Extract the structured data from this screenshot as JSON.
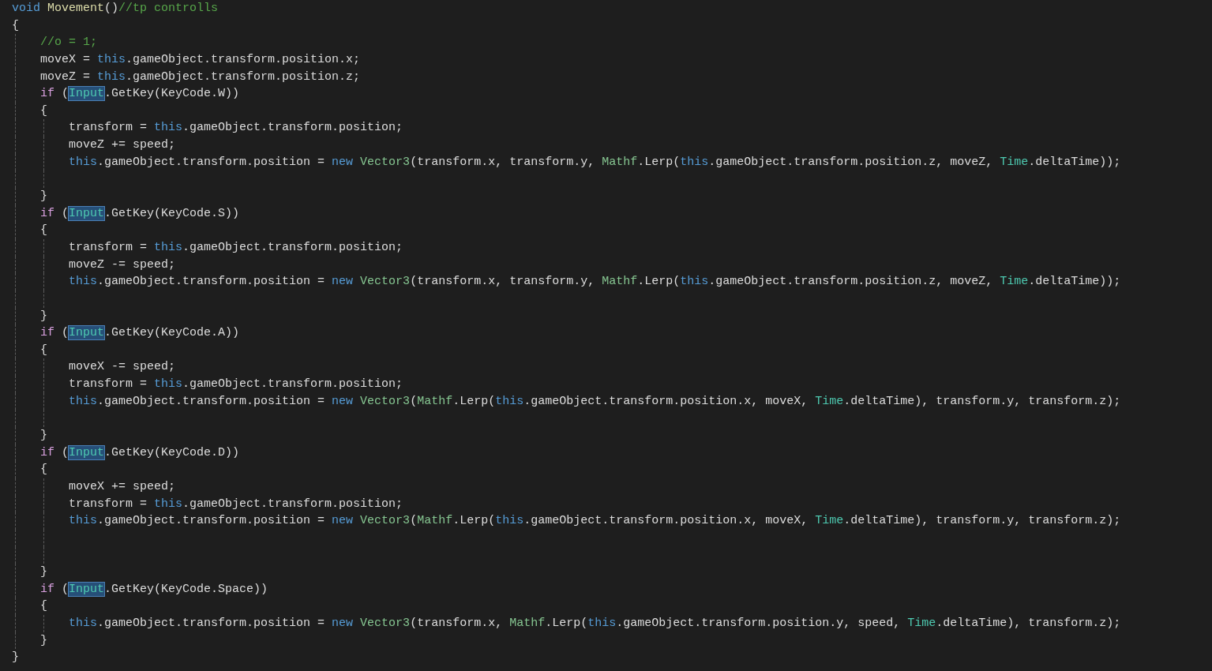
{
  "editor": {
    "lines": [
      {
        "kind": "code",
        "tokens": [
          {
            "text": "void ",
            "kind": "keyword"
          },
          {
            "text": "Movement",
            "kind": "function"
          },
          {
            "text": "()",
            "kind": "plain"
          },
          {
            "text": "//tp controlls",
            "kind": "comment"
          }
        ]
      },
      {
        "kind": "code",
        "tokens": [
          {
            "text": "{",
            "kind": "plain"
          }
        ]
      },
      {
        "kind": "code",
        "tokens": [
          {
            "text": "    //o = 1;",
            "kind": "comment"
          }
        ]
      },
      {
        "kind": "code",
        "tokens": [
          {
            "text": "    moveX = ",
            "kind": "plain"
          },
          {
            "text": "this",
            "kind": "keyword"
          },
          {
            "text": ".gameObject.transform.position.x;",
            "kind": "plain"
          }
        ]
      },
      {
        "kind": "code",
        "tokens": [
          {
            "text": "    moveZ = ",
            "kind": "plain"
          },
          {
            "text": "this",
            "kind": "keyword"
          },
          {
            "text": ".gameObject.transform.position.z;",
            "kind": "plain"
          }
        ]
      },
      {
        "kind": "code",
        "tokens": [
          {
            "text": "    if",
            "kind": "control"
          },
          {
            "text": " (",
            "kind": "plain"
          },
          {
            "text": "Input",
            "kind": "type",
            "highlighted": true
          },
          {
            "text": ".GetKey(KeyCode.W))",
            "kind": "plain"
          }
        ]
      },
      {
        "kind": "code",
        "tokens": [
          {
            "text": "    {",
            "kind": "plain"
          }
        ]
      },
      {
        "kind": "code",
        "tokens": [
          {
            "text": "        transform = ",
            "kind": "plain"
          },
          {
            "text": "this",
            "kind": "keyword"
          },
          {
            "text": ".gameObject.transform.position;",
            "kind": "plain"
          }
        ]
      },
      {
        "kind": "code",
        "tokens": [
          {
            "text": "        moveZ += speed;",
            "kind": "plain"
          }
        ]
      },
      {
        "kind": "code",
        "tokens": [
          {
            "text": "        this",
            "kind": "keyword"
          },
          {
            "text": ".gameObject.transform.position = ",
            "kind": "plain"
          },
          {
            "text": "new ",
            "kind": "keyword"
          },
          {
            "text": "Vector3",
            "kind": "struct"
          },
          {
            "text": "(transform.x, transform.y, ",
            "kind": "plain"
          },
          {
            "text": "Mathf",
            "kind": "struct"
          },
          {
            "text": ".Lerp(",
            "kind": "plain"
          },
          {
            "text": "this",
            "kind": "keyword"
          },
          {
            "text": ".gameObject.transform.position.z, moveZ, ",
            "kind": "plain"
          },
          {
            "text": "Time",
            "kind": "type"
          },
          {
            "text": ".deltaTime));",
            "kind": "plain"
          }
        ]
      },
      {
        "kind": "blank"
      },
      {
        "kind": "code",
        "tokens": [
          {
            "text": "    }",
            "kind": "plain"
          }
        ]
      },
      {
        "kind": "code",
        "tokens": [
          {
            "text": "    if",
            "kind": "control"
          },
          {
            "text": " (",
            "kind": "plain"
          },
          {
            "text": "Input",
            "kind": "type",
            "highlighted": true
          },
          {
            "text": ".GetKey(KeyCode.S))",
            "kind": "plain"
          }
        ]
      },
      {
        "kind": "code",
        "tokens": [
          {
            "text": "    {",
            "kind": "plain"
          }
        ]
      },
      {
        "kind": "code",
        "tokens": [
          {
            "text": "        transform = ",
            "kind": "plain"
          },
          {
            "text": "this",
            "kind": "keyword"
          },
          {
            "text": ".gameObject.transform.position;",
            "kind": "plain"
          }
        ]
      },
      {
        "kind": "code",
        "tokens": [
          {
            "text": "        moveZ -= speed;",
            "kind": "plain"
          }
        ]
      },
      {
        "kind": "code",
        "tokens": [
          {
            "text": "        this",
            "kind": "keyword"
          },
          {
            "text": ".gameObject.transform.position = ",
            "kind": "plain"
          },
          {
            "text": "new ",
            "kind": "keyword"
          },
          {
            "text": "Vector3",
            "kind": "struct"
          },
          {
            "text": "(transform.x, transform.y, ",
            "kind": "plain"
          },
          {
            "text": "Mathf",
            "kind": "struct"
          },
          {
            "text": ".Lerp(",
            "kind": "plain"
          },
          {
            "text": "this",
            "kind": "keyword"
          },
          {
            "text": ".gameObject.transform.position.z, moveZ, ",
            "kind": "plain"
          },
          {
            "text": "Time",
            "kind": "type"
          },
          {
            "text": ".deltaTime));",
            "kind": "plain"
          }
        ]
      },
      {
        "kind": "blank"
      },
      {
        "kind": "code",
        "tokens": [
          {
            "text": "    }",
            "kind": "plain"
          }
        ]
      },
      {
        "kind": "code",
        "tokens": [
          {
            "text": "    if",
            "kind": "control"
          },
          {
            "text": " (",
            "kind": "plain"
          },
          {
            "text": "Input",
            "kind": "type",
            "highlighted": true
          },
          {
            "text": ".GetKey(KeyCode.A))",
            "kind": "plain"
          }
        ]
      },
      {
        "kind": "code",
        "tokens": [
          {
            "text": "    {",
            "kind": "plain"
          }
        ]
      },
      {
        "kind": "code",
        "tokens": [
          {
            "text": "        moveX -= speed;",
            "kind": "plain"
          }
        ]
      },
      {
        "kind": "code",
        "tokens": [
          {
            "text": "        transform = ",
            "kind": "plain"
          },
          {
            "text": "this",
            "kind": "keyword"
          },
          {
            "text": ".gameObject.transform.position;",
            "kind": "plain"
          }
        ]
      },
      {
        "kind": "code",
        "tokens": [
          {
            "text": "        this",
            "kind": "keyword"
          },
          {
            "text": ".gameObject.transform.position = ",
            "kind": "plain"
          },
          {
            "text": "new ",
            "kind": "keyword"
          },
          {
            "text": "Vector3",
            "kind": "struct"
          },
          {
            "text": "(",
            "kind": "plain"
          },
          {
            "text": "Mathf",
            "kind": "struct"
          },
          {
            "text": ".Lerp(",
            "kind": "plain"
          },
          {
            "text": "this",
            "kind": "keyword"
          },
          {
            "text": ".gameObject.transform.position.x, moveX, ",
            "kind": "plain"
          },
          {
            "text": "Time",
            "kind": "type"
          },
          {
            "text": ".deltaTime), transform.y, transform.z);",
            "kind": "plain"
          }
        ]
      },
      {
        "kind": "blank"
      },
      {
        "kind": "code",
        "tokens": [
          {
            "text": "    }",
            "kind": "plain"
          }
        ]
      },
      {
        "kind": "code",
        "tokens": [
          {
            "text": "    if",
            "kind": "control"
          },
          {
            "text": " (",
            "kind": "plain"
          },
          {
            "text": "Input",
            "kind": "type",
            "highlighted": true
          },
          {
            "text": ".GetKey(KeyCode.D))",
            "kind": "plain"
          }
        ]
      },
      {
        "kind": "code",
        "tokens": [
          {
            "text": "    {",
            "kind": "plain"
          }
        ]
      },
      {
        "kind": "code",
        "tokens": [
          {
            "text": "        moveX += speed;",
            "kind": "plain"
          }
        ]
      },
      {
        "kind": "code",
        "tokens": [
          {
            "text": "        transform = ",
            "kind": "plain"
          },
          {
            "text": "this",
            "kind": "keyword"
          },
          {
            "text": ".gameObject.transform.position;",
            "kind": "plain"
          }
        ]
      },
      {
        "kind": "code",
        "tokens": [
          {
            "text": "        this",
            "kind": "keyword"
          },
          {
            "text": ".gameObject.transform.position = ",
            "kind": "plain"
          },
          {
            "text": "new ",
            "kind": "keyword"
          },
          {
            "text": "Vector3",
            "kind": "struct"
          },
          {
            "text": "(",
            "kind": "plain"
          },
          {
            "text": "Mathf",
            "kind": "struct"
          },
          {
            "text": ".Lerp(",
            "kind": "plain"
          },
          {
            "text": "this",
            "kind": "keyword"
          },
          {
            "text": ".gameObject.transform.position.x, moveX, ",
            "kind": "plain"
          },
          {
            "text": "Time",
            "kind": "type"
          },
          {
            "text": ".deltaTime), transform.y, transform.z);",
            "kind": "plain"
          }
        ]
      },
      {
        "kind": "blank"
      },
      {
        "kind": "blank"
      },
      {
        "kind": "code",
        "tokens": [
          {
            "text": "    }",
            "kind": "plain"
          }
        ]
      },
      {
        "kind": "code",
        "tokens": [
          {
            "text": "    if",
            "kind": "control"
          },
          {
            "text": " (",
            "kind": "plain"
          },
          {
            "text": "Input",
            "kind": "type",
            "highlighted": true
          },
          {
            "text": ".GetKey(KeyCode.Space))",
            "kind": "plain"
          }
        ]
      },
      {
        "kind": "code",
        "tokens": [
          {
            "text": "    {",
            "kind": "plain"
          }
        ]
      },
      {
        "kind": "code",
        "tokens": [
          {
            "text": "        this",
            "kind": "keyword"
          },
          {
            "text": ".gameObject.transform.position = ",
            "kind": "plain"
          },
          {
            "text": "new ",
            "kind": "keyword"
          },
          {
            "text": "Vector3",
            "kind": "struct"
          },
          {
            "text": "(transform.x, ",
            "kind": "plain"
          },
          {
            "text": "Mathf",
            "kind": "struct"
          },
          {
            "text": ".Lerp(",
            "kind": "plain"
          },
          {
            "text": "this",
            "kind": "keyword"
          },
          {
            "text": ".gameObject.transform.position.y, speed, ",
            "kind": "plain"
          },
          {
            "text": "Time",
            "kind": "type"
          },
          {
            "text": ".deltaTime), transform.z);",
            "kind": "plain"
          }
        ]
      },
      {
        "kind": "code",
        "tokens": [
          {
            "text": "    }",
            "kind": "plain"
          }
        ]
      },
      {
        "kind": "code",
        "tokens": [
          {
            "text": "}",
            "kind": "plain"
          }
        ]
      }
    ]
  }
}
